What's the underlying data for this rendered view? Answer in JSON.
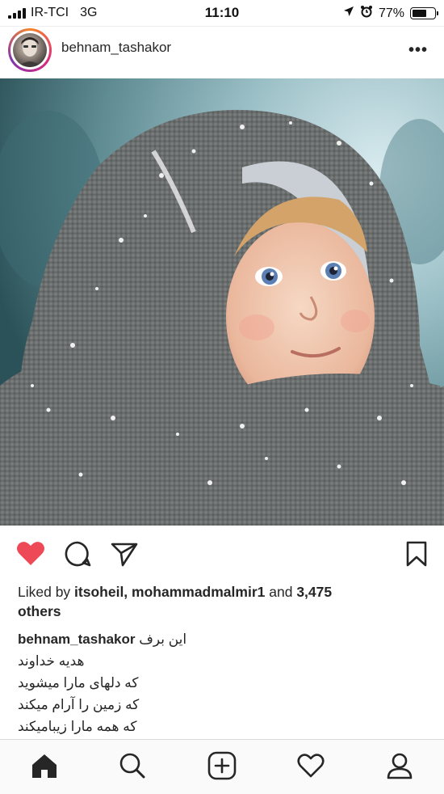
{
  "status_bar": {
    "carrier": "IR-TCI",
    "network": "3G",
    "time": "11:10",
    "battery_percent": "77%",
    "battery_level": 0.77
  },
  "post": {
    "username": "behnam_tashakor",
    "more_label": "•••",
    "liked": true,
    "likes": {
      "prefix": "Liked by ",
      "users": "itsoheil, mohammadmalmir1",
      "conjunction": " and ",
      "count": "3,475",
      "suffix": "others"
    },
    "caption": {
      "username": "behnam_tashakor",
      "lines": [
        "این برف",
        "هدیه خداوند",
        "که دلهای مارا میشوید",
        "که زمین را آرام میکند",
        "که همه مارا زیبامیکند"
      ]
    }
  },
  "colors": {
    "like_red": "#ed4956",
    "text": "#262626"
  },
  "tab_bar": {
    "items": [
      "home-icon",
      "search-icon",
      "add-post-icon",
      "activity-icon",
      "profile-icon"
    ]
  }
}
